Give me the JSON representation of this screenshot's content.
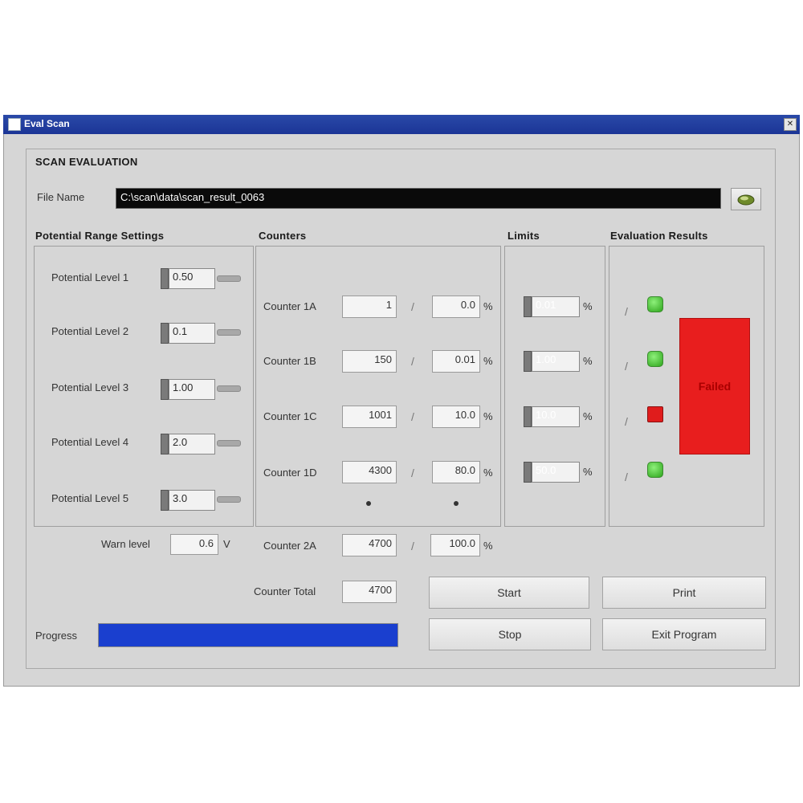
{
  "window": {
    "title": "Eval Scan"
  },
  "header": {
    "title": "SCAN EVALUATION",
    "file_label": "File Name",
    "file_path": "C:\\scan\\data\\scan_result_0063"
  },
  "potential": {
    "heading": "Potential Range Settings",
    "levels": [
      {
        "label": "Potential Level 1",
        "value": "0.50"
      },
      {
        "label": "Potential Level 2",
        "value": "0.1"
      },
      {
        "label": "Potential Level 3",
        "value": "1.00"
      },
      {
        "label": "Potential Level 4",
        "value": "2.0"
      },
      {
        "label": "Potential Level 5",
        "value": "3.0"
      }
    ],
    "warn_label": "Warn level",
    "warn_value": "0.6",
    "warn_unit": "V"
  },
  "counters": {
    "heading": "Counters",
    "rows": [
      {
        "label": "Counter 1A",
        "value": "1",
        "pct": "0.0",
        "unit": "%"
      },
      {
        "label": "Counter 1B",
        "value": "150",
        "pct": "0.01",
        "unit": "%"
      },
      {
        "label": "Counter 1C",
        "value": "1001",
        "pct": "10.0",
        "unit": "%"
      },
      {
        "label": "Counter 1D",
        "value": "4300",
        "pct": "80.0",
        "unit": "%"
      }
    ],
    "extra_row": {
      "label": "Counter 2A",
      "value": "4700",
      "pct": "100.0",
      "unit": "%"
    },
    "total_row": {
      "label": "Counter Total",
      "value": "4700"
    }
  },
  "limits": {
    "heading": "Limits",
    "values": [
      "0.01",
      "1.00",
      "10.0",
      "50.0"
    ],
    "unit": "%"
  },
  "results": {
    "heading": "Evaluation Results",
    "states": [
      "ok",
      "ok",
      "fail",
      "ok"
    ],
    "overall": "Failed",
    "colors": {
      "ok": "#2ea51c",
      "fail": "#e01c1c"
    }
  },
  "progress": {
    "label": "Progress",
    "fraction": 1.0,
    "color": "#1a3fcf"
  },
  "buttons": {
    "start": "Start",
    "print": "Print",
    "stop": "Stop",
    "exit": "Exit Program"
  }
}
